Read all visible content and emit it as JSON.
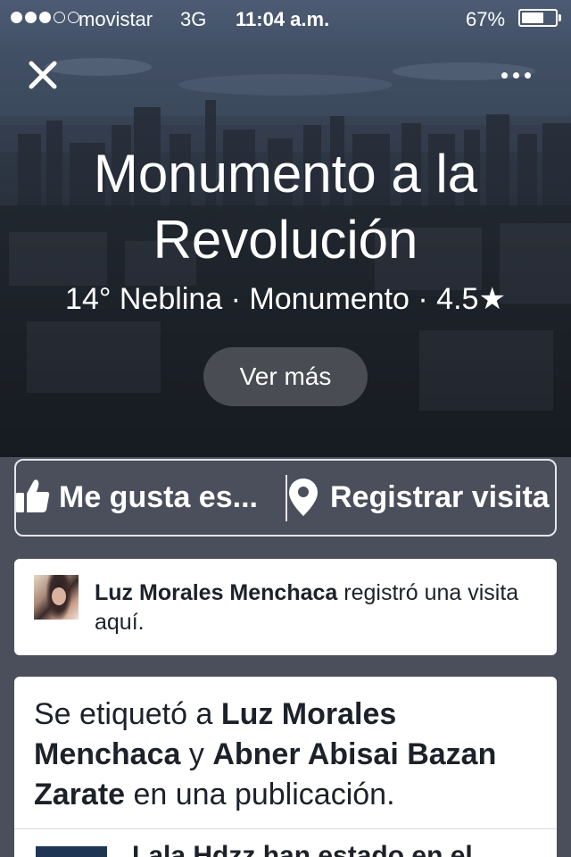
{
  "status_bar": {
    "carrier": "movistar",
    "network": "3G",
    "time": "11:04 a.m.",
    "battery_percent": "67%",
    "battery_level": 0.67,
    "signal_bars": 3,
    "signal_max": 5
  },
  "hero": {
    "title": "Monumento a la Revolución",
    "subtitle": "14° Neblina · Monumento · 4.5★",
    "see_more_label": "Ver más"
  },
  "icons": {
    "close": "close-icon",
    "more": "more-icon",
    "like": "thumbs-up-icon",
    "checkin": "location-pin-icon"
  },
  "actions": {
    "like_label": "Me gusta es...",
    "checkin_label": "Registrar visita"
  },
  "activity": {
    "checkin_user": "Luz Morales Menchaca",
    "checkin_text": " registró una visita aquí."
  },
  "tagged": {
    "prefix": "Se etiquetó a ",
    "person1": "Luz Morales Menchaca",
    "connector": " y ",
    "person2": "Abner Abisai Bazan Zarate",
    "suffix": " en una publicación.",
    "post_title_partial": "Lala Hdzz han estado en el"
  },
  "colors": {
    "background": "#4b4f5c",
    "text_dark": "#1d2129",
    "card": "#ffffff"
  }
}
